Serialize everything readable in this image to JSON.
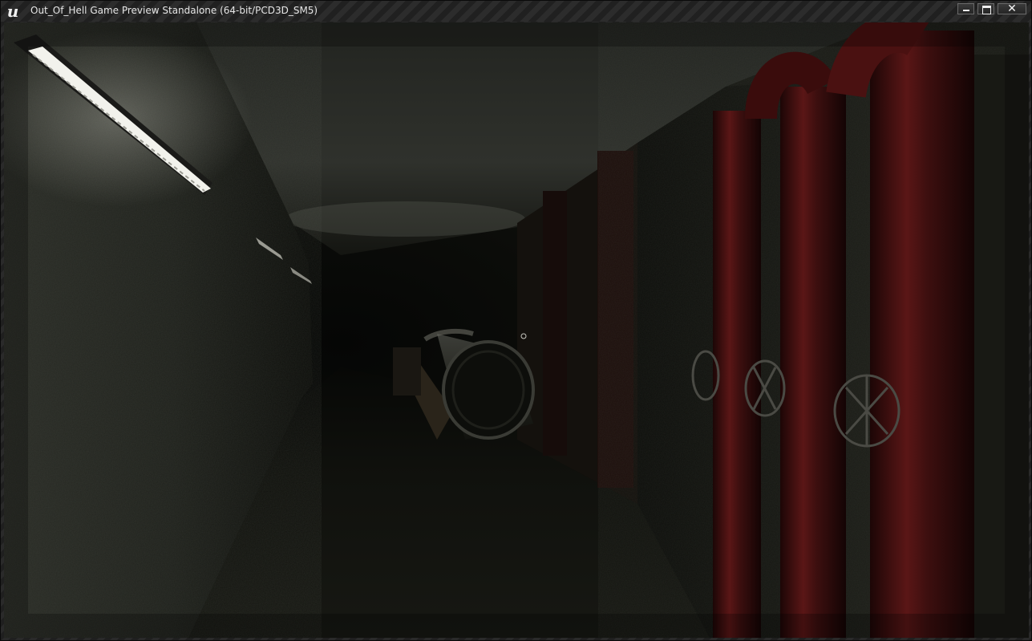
{
  "window": {
    "title": "Out_Of_Hell Game Preview Standalone (64-bit/PCD3D_SM5)",
    "logo_icon": "unreal-engine-logo-icon",
    "logo_glyph": "u",
    "controls": {
      "minimize_icon": "minimize-icon",
      "maximize_icon": "maximize-icon",
      "close_icon": "close-icon",
      "close_glyph": "✕"
    }
  },
  "scene": {
    "description_elements": [
      "fluorescent-ceiling-light",
      "wall-lamp",
      "concrete-tunnel",
      "metal-barrel",
      "red-pipes",
      "valve-wheel",
      "crosshair"
    ],
    "colors": {
      "pipe_red": "#5a1414",
      "concrete": "#2e302a",
      "darkness": "#050604",
      "light": "#f2f2ec"
    }
  }
}
